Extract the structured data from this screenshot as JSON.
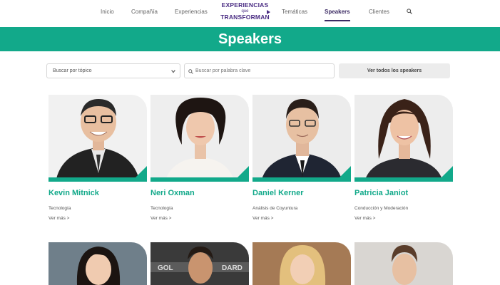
{
  "nav": {
    "items": [
      "Inicio",
      "Compañía",
      "Experiencias",
      "Temáticas",
      "Speakers",
      "Clientes"
    ],
    "active": "Speakers",
    "logo": {
      "line1": "EXPERIENCIAS",
      "line2": "que",
      "line3": "TRANSFORMAN"
    }
  },
  "banner": {
    "title": "Speakers"
  },
  "filters": {
    "topic_select_value": "Buscar por tópico",
    "keyword_placeholder": "Buscar por palabra clave",
    "view_all_label": "Ver todos los speakers"
  },
  "speakers": [
    {
      "name": "Kevin Mitnick",
      "topic": "Tecnología",
      "more": "Ver más >"
    },
    {
      "name": "Neri Oxman",
      "topic": "Tecnología",
      "more": "Ver más >"
    },
    {
      "name": "Daniel Kerner",
      "topic": "Análisis de Coyuntura",
      "more": "Ver más >"
    },
    {
      "name": "Patricia Janiot",
      "topic": "Conducción y Moderación",
      "more": "Ver más >"
    }
  ],
  "colors": {
    "accent": "#12a98a",
    "brand": "#4a2c83"
  }
}
